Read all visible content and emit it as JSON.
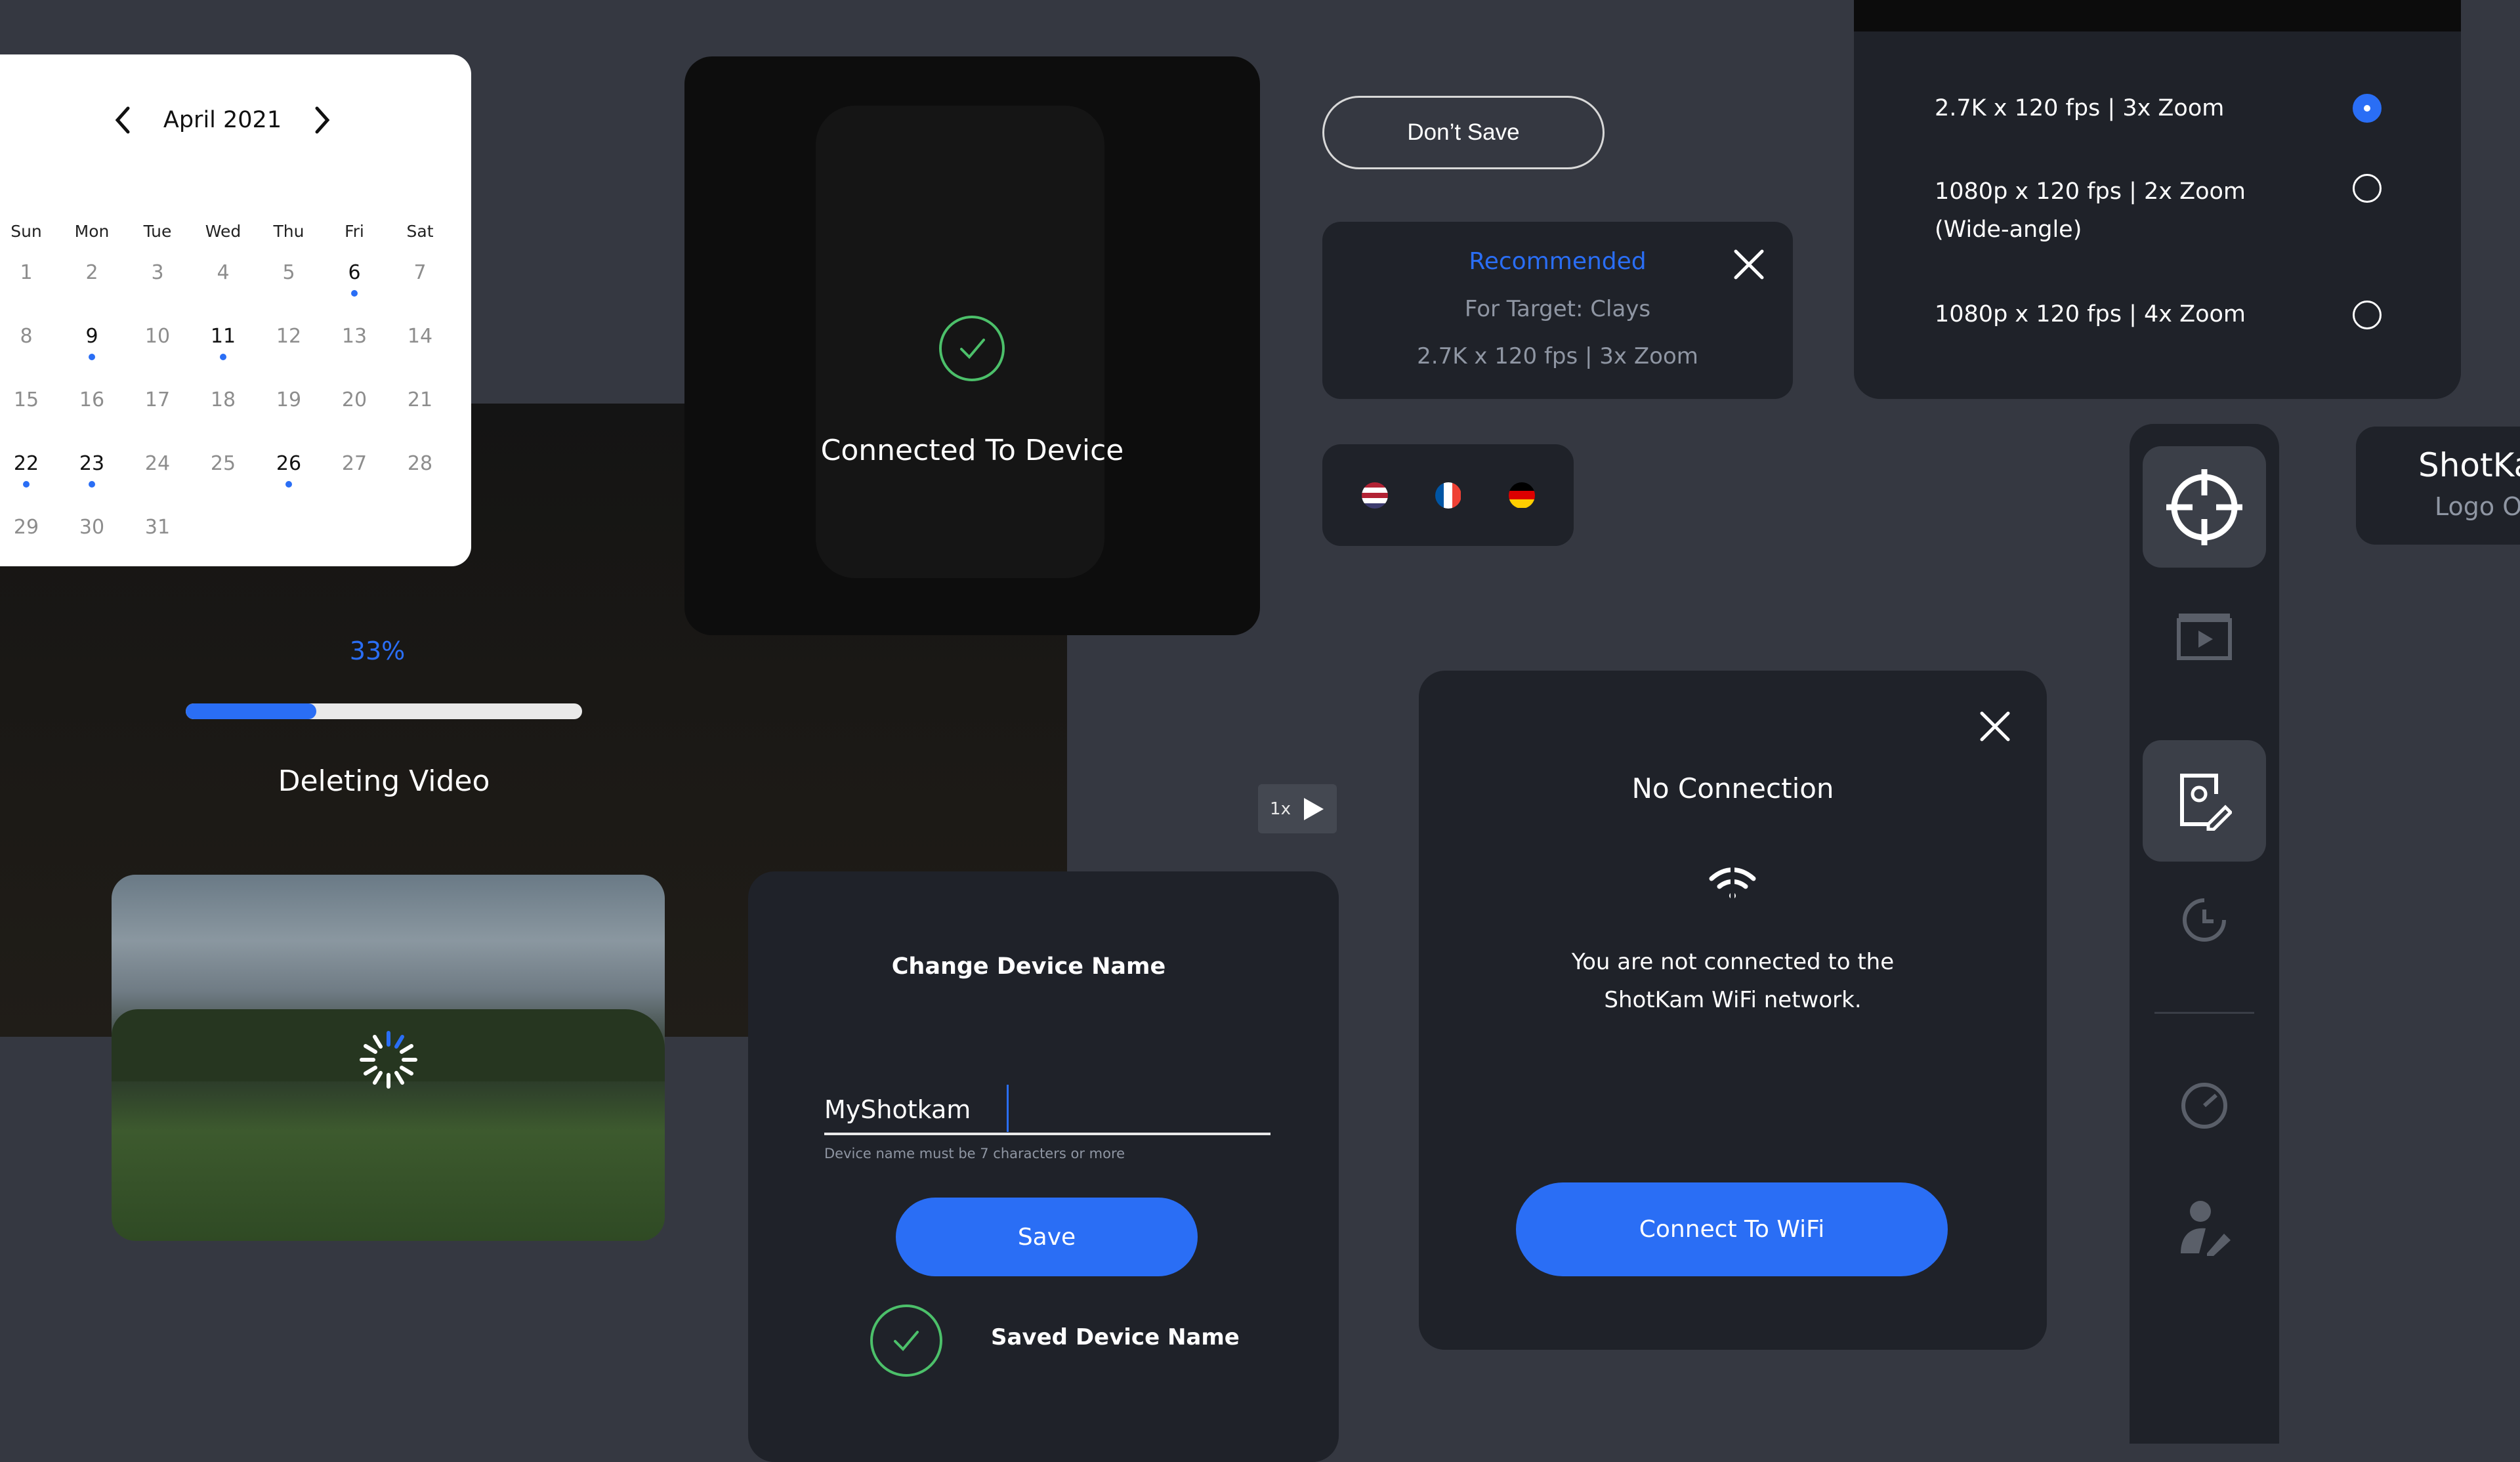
{
  "calendar": {
    "month": "April 2021",
    "weekdays": [
      "Sun",
      "Mon",
      "Tue",
      "Wed",
      "Thu",
      "Fri",
      "Sat"
    ],
    "weeks": [
      [
        "1",
        "2",
        "3",
        "4",
        "5",
        "6",
        "7"
      ],
      [
        "8",
        "9",
        "10",
        "11",
        "12",
        "13",
        "14"
      ],
      [
        "15",
        "16",
        "17",
        "18",
        "19",
        "20",
        "21"
      ],
      [
        "22",
        "23",
        "24",
        "25",
        "26",
        "27",
        "28"
      ],
      [
        "29",
        "30",
        "31",
        "",
        "",
        "",
        ""
      ]
    ],
    "event_days": [
      "6",
      "9",
      "11",
      "22",
      "23",
      "26"
    ]
  },
  "progress": {
    "percent_label": "33%",
    "value": 0.33,
    "label": "Deleting Video"
  },
  "connected": {
    "label": "Connected To Device"
  },
  "dont_save": {
    "label": "Don’t Save"
  },
  "recommended": {
    "title": "Recommended",
    "target": "For Target: Clays",
    "resolution": "2.7K x 120 fps | 3x Zoom"
  },
  "flags": [
    "us-flag-icon",
    "fr-flag-icon",
    "de-flag-icon"
  ],
  "resolution_options": {
    "items": [
      {
        "line1": "2.7K x 120 fps | 3x Zoom",
        "line2": "",
        "selected": true
      },
      {
        "line1": "1080p x 120 fps | 2x Zoom",
        "line2": "(Wide-angle)",
        "selected": false
      },
      {
        "line1": "1080p x 120 fps | 4x Zoom",
        "line2": "",
        "selected": false
      }
    ]
  },
  "sidebar": {
    "items": [
      "crosshair-icon",
      "video-icon",
      "settings-edit-icon",
      "history-icon",
      "speedometer-icon",
      "user-edit-icon"
    ],
    "active": [
      "crosshair-icon",
      "settings-edit-icon"
    ]
  },
  "logo_card": {
    "title": "ShotKa",
    "subtitle": "Logo O"
  },
  "playback": {
    "speed": "1x"
  },
  "rename": {
    "title": "Change Device Name",
    "value": "MyShotkam",
    "hint": "Device name must be 7 characters or more",
    "save_label": "Save",
    "saved_label": "Saved Device Name"
  },
  "no_connection": {
    "title": "No Connection",
    "message_line1": "You are not connected to the",
    "message_line2": "ShotKam WiFi network.",
    "button_label": "Connect To WiFi"
  },
  "colors": {
    "accent": "#2a6ef5",
    "success": "#4cc06a",
    "panel": "#1f2229",
    "background": "#353841"
  }
}
